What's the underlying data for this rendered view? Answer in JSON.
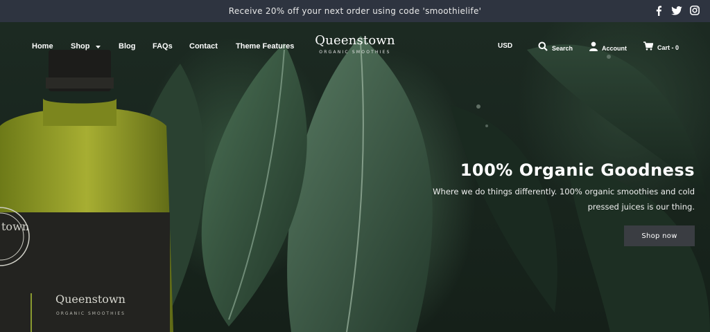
{
  "announcement": {
    "text": "Receive 20% off your next order using code 'smoothielife'"
  },
  "social": [
    {
      "icon": "facebook-icon"
    },
    {
      "icon": "twitter-icon"
    },
    {
      "icon": "instagram-icon"
    }
  ],
  "nav": {
    "items": [
      {
        "label": "Home"
      },
      {
        "label": "Shop",
        "dropdown": true
      },
      {
        "label": "Blog"
      },
      {
        "label": "FAQs"
      },
      {
        "label": "Contact"
      },
      {
        "label": "Theme Features"
      }
    ]
  },
  "brand": {
    "name": "Queenstown",
    "tagline": "ORGANIC SMOOTHIES"
  },
  "header_right": {
    "currency": "USD",
    "search": "Search",
    "account": "Account",
    "cart": "Cart - 0"
  },
  "hero": {
    "title": "100% Organic Goodness",
    "subtitle_line1": "Where we do things differently. 100% organic smoothies and cold",
    "subtitle_line2": "pressed juices is our thing.",
    "cta": "Shop now"
  },
  "bottle": {
    "brand": "Queenstown",
    "tagline": "ORGANIC SMOOTHIES",
    "seal_text": "town"
  },
  "colors": {
    "announce_bg": "#2e3440",
    "button_bg": "#3a3d42",
    "text": "#ffffff"
  }
}
